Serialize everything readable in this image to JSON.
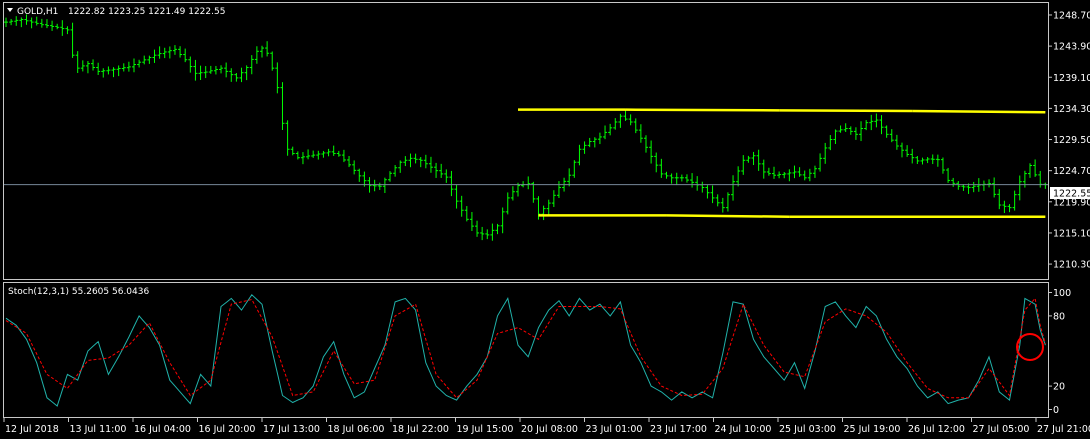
{
  "colors": {
    "background": "#000000",
    "frame": "#c8c8c8",
    "bars": "#00ff00",
    "trendlines": "#ffff00",
    "stoch_main": "#20b2aa",
    "stoch_signal": "#ff0000",
    "annotation_circle": "#ff0000",
    "price_line": "#778899"
  },
  "header": {
    "symbol": "GOLD,H1",
    "ohlc": "1222.82 1223.25 1221.49 1222.55",
    "arrow_icon": "triangle-down-icon"
  },
  "stoch_header": {
    "title": "Stoch(12,3,1) 55.2605 56.0436"
  },
  "chart_data": [
    {
      "type": "line",
      "title": "GOLD,H1",
      "representation": "price bars (H1)",
      "ylim": [
        1208.0,
        1250.7
      ],
      "y_ticks": [
        "1248.70",
        "1243.90",
        "1239.10",
        "1234.30",
        "1229.50",
        "1224.70",
        "1219.90",
        "1215.10",
        "1210.30"
      ],
      "current_price": "1222.55",
      "x_ticks": [
        "12 Jul 2018",
        "13 Jul 11:00",
        "16 Jul 04:00",
        "16 Jul 20:00",
        "17 Jul 13:00",
        "18 Jul 06:00",
        "18 Jul 22:00",
        "19 Jul 15:00",
        "20 Jul 08:00",
        "23 Jul 01:00",
        "23 Jul 17:00",
        "24 Jul 10:00",
        "25 Jul 03:00",
        "25 Jul 19:00",
        "26 Jul 12:00",
        "27 Jul 05:00",
        "27 Jul 21:00"
      ],
      "anchors": [
        [
          0,
          1247.6
        ],
        [
          3,
          1248.0
        ],
        [
          7,
          1247.2
        ],
        [
          10,
          1246.8
        ],
        [
          12,
          1246.4
        ],
        [
          13,
          1242.5
        ],
        [
          14,
          1240.5
        ],
        [
          16,
          1241.2
        ],
        [
          18,
          1240.0
        ],
        [
          20,
          1240.2
        ],
        [
          24,
          1240.7
        ],
        [
          29,
          1242.5
        ],
        [
          31,
          1243.0
        ],
        [
          33,
          1243.4
        ],
        [
          35,
          1241.8
        ],
        [
          37,
          1239.7
        ],
        [
          39,
          1239.9
        ],
        [
          42,
          1240.5
        ],
        [
          45,
          1239.0
        ],
        [
          47,
          1240.6
        ],
        [
          49,
          1243.1
        ],
        [
          50,
          1243.6
        ],
        [
          51,
          1242.8
        ],
        [
          52,
          1240.5
        ],
        [
          53,
          1237.5
        ],
        [
          54,
          1232.0
        ],
        [
          55,
          1228.0
        ],
        [
          57,
          1226.7
        ],
        [
          60,
          1227.1
        ],
        [
          63,
          1227.6
        ],
        [
          65,
          1227.1
        ],
        [
          67,
          1225.6
        ],
        [
          69,
          1223.9
        ],
        [
          71,
          1222.4
        ],
        [
          73,
          1222.3
        ],
        [
          75,
          1224.3
        ],
        [
          77,
          1226.0
        ],
        [
          79,
          1226.6
        ],
        [
          81,
          1226.3
        ],
        [
          84,
          1224.7
        ],
        [
          86,
          1223.7
        ],
        [
          88,
          1220.0
        ],
        [
          90,
          1217.2
        ],
        [
          92,
          1215.1
        ],
        [
          94,
          1214.8
        ],
        [
          96,
          1216.2
        ],
        [
          98,
          1220.5
        ],
        [
          100,
          1222.4
        ],
        [
          102,
          1222.7
        ],
        [
          104,
          1218.0
        ],
        [
          106,
          1219.7
        ],
        [
          108,
          1222.1
        ],
        [
          110,
          1224.0
        ],
        [
          112,
          1228.0
        ],
        [
          114,
          1229.2
        ],
        [
          116,
          1229.9
        ],
        [
          118,
          1231.3
        ],
        [
          120,
          1233.1
        ],
        [
          122,
          1232.2
        ],
        [
          124,
          1229.7
        ],
        [
          126,
          1226.9
        ],
        [
          128,
          1224.2
        ],
        [
          130,
          1223.6
        ],
        [
          132,
          1223.6
        ],
        [
          134,
          1222.9
        ],
        [
          136,
          1222.1
        ],
        [
          138,
          1220.5
        ],
        [
          140,
          1219.0
        ],
        [
          142,
          1223.0
        ],
        [
          144,
          1226.3
        ],
        [
          146,
          1227.0
        ],
        [
          148,
          1224.5
        ],
        [
          150,
          1224.0
        ],
        [
          152,
          1224.2
        ],
        [
          154,
          1224.5
        ],
        [
          156,
          1223.6
        ],
        [
          158,
          1225.0
        ],
        [
          160,
          1228.2
        ],
        [
          162,
          1230.8
        ],
        [
          164,
          1231.2
        ],
        [
          166,
          1230.3
        ],
        [
          168,
          1232.1
        ],
        [
          170,
          1232.5
        ],
        [
          172,
          1230.3
        ],
        [
          174,
          1228.5
        ],
        [
          176,
          1227.2
        ],
        [
          178,
          1226.2
        ],
        [
          180,
          1226.5
        ],
        [
          182,
          1226.4
        ],
        [
          184,
          1223.2
        ],
        [
          186,
          1222.3
        ],
        [
          188,
          1222.1
        ],
        [
          190,
          1222.5
        ],
        [
          192,
          1222.7
        ],
        [
          194,
          1219.4
        ],
        [
          196,
          1219.0
        ],
        [
          198,
          1223.0
        ],
        [
          200,
          1225.5
        ],
        [
          202,
          1222.6
        ],
        [
          203,
          1222.55
        ]
      ],
      "trendlines": [
        {
          "name": "resistance",
          "segments": [
            [
              100,
              1234.1
            ],
            [
              121,
              1234.1
            ],
            [
              151,
              1234.0
            ],
            [
              177,
              1233.9
            ],
            [
              203,
              1233.7
            ]
          ]
        },
        {
          "name": "support",
          "segments": [
            [
              104,
              1217.8
            ],
            [
              129,
              1217.8
            ],
            [
              153,
              1217.6
            ],
            [
              203,
              1217.6
            ]
          ]
        }
      ]
    },
    {
      "type": "line",
      "title": "Stoch(12,3,1) 55.2605 56.0436",
      "ylim": [
        -3,
        103
      ],
      "y_ticks": [
        "100",
        "80",
        "20",
        "0"
      ],
      "series": [
        {
          "name": "main",
          "anchors": [
            [
              0,
              78
            ],
            [
              2,
              72
            ],
            [
              4,
              60
            ],
            [
              6,
              40
            ],
            [
              8,
              10
            ],
            [
              10,
              3
            ],
            [
              12,
              30
            ],
            [
              14,
              25
            ],
            [
              16,
              50
            ],
            [
              18,
              58
            ],
            [
              20,
              30
            ],
            [
              22,
              45
            ],
            [
              24,
              62
            ],
            [
              26,
              80
            ],
            [
              28,
              70
            ],
            [
              30,
              55
            ],
            [
              32,
              25
            ],
            [
              34,
              15
            ],
            [
              36,
              5
            ],
            [
              38,
              30
            ],
            [
              40,
              20
            ],
            [
              42,
              88
            ],
            [
              44,
              95
            ],
            [
              46,
              85
            ],
            [
              48,
              98
            ],
            [
              50,
              90
            ],
            [
              52,
              50
            ],
            [
              54,
              12
            ],
            [
              56,
              6
            ],
            [
              58,
              10
            ],
            [
              60,
              20
            ],
            [
              62,
              45
            ],
            [
              64,
              58
            ],
            [
              66,
              30
            ],
            [
              68,
              10
            ],
            [
              70,
              15
            ],
            [
              72,
              35
            ],
            [
              74,
              55
            ],
            [
              76,
              92
            ],
            [
              78,
              95
            ],
            [
              80,
              85
            ],
            [
              82,
              40
            ],
            [
              84,
              20
            ],
            [
              86,
              12
            ],
            [
              88,
              8
            ],
            [
              90,
              20
            ],
            [
              92,
              30
            ],
            [
              94,
              45
            ],
            [
              96,
              80
            ],
            [
              98,
              95
            ],
            [
              100,
              55
            ],
            [
              102,
              45
            ],
            [
              104,
              70
            ],
            [
              106,
              85
            ],
            [
              108,
              93
            ],
            [
              110,
              80
            ],
            [
              112,
              95
            ],
            [
              114,
              85
            ],
            [
              116,
              90
            ],
            [
              118,
              80
            ],
            [
              120,
              92
            ],
            [
              122,
              55
            ],
            [
              124,
              40
            ],
            [
              126,
              20
            ],
            [
              128,
              15
            ],
            [
              130,
              8
            ],
            [
              132,
              15
            ],
            [
              134,
              10
            ],
            [
              136,
              15
            ],
            [
              138,
              10
            ],
            [
              140,
              48
            ],
            [
              142,
              92
            ],
            [
              144,
              90
            ],
            [
              146,
              60
            ],
            [
              148,
              45
            ],
            [
              150,
              35
            ],
            [
              152,
              25
            ],
            [
              154,
              40
            ],
            [
              156,
              18
            ],
            [
              158,
              50
            ],
            [
              160,
              88
            ],
            [
              162,
              92
            ],
            [
              164,
              80
            ],
            [
              166,
              70
            ],
            [
              168,
              88
            ],
            [
              170,
              80
            ],
            [
              172,
              60
            ],
            [
              174,
              45
            ],
            [
              176,
              35
            ],
            [
              178,
              20
            ],
            [
              180,
              10
            ],
            [
              182,
              15
            ],
            [
              184,
              5
            ],
            [
              186,
              8
            ],
            [
              188,
              10
            ],
            [
              190,
              25
            ],
            [
              192,
              45
            ],
            [
              194,
              15
            ],
            [
              196,
              8
            ],
            [
              198,
              55
            ],
            [
              199,
              95
            ],
            [
              201,
              90
            ],
            [
              202,
              68
            ],
            [
              203,
              55
            ]
          ]
        },
        {
          "name": "signal",
          "anchors": [
            [
              0,
              76
            ],
            [
              4,
              65
            ],
            [
              8,
              30
            ],
            [
              12,
              18
            ],
            [
              16,
              42
            ],
            [
              20,
              44
            ],
            [
              24,
              55
            ],
            [
              28,
              74
            ],
            [
              32,
              40
            ],
            [
              36,
              12
            ],
            [
              40,
              25
            ],
            [
              44,
              90
            ],
            [
              48,
              94
            ],
            [
              52,
              62
            ],
            [
              56,
              12
            ],
            [
              60,
              15
            ],
            [
              64,
              50
            ],
            [
              68,
              22
            ],
            [
              72,
              25
            ],
            [
              76,
              80
            ],
            [
              80,
              90
            ],
            [
              84,
              30
            ],
            [
              88,
              10
            ],
            [
              92,
              25
            ],
            [
              96,
              65
            ],
            [
              100,
              70
            ],
            [
              104,
              60
            ],
            [
              108,
              88
            ],
            [
              112,
              88
            ],
            [
              116,
              88
            ],
            [
              120,
              86
            ],
            [
              124,
              45
            ],
            [
              128,
              20
            ],
            [
              132,
              12
            ],
            [
              136,
              13
            ],
            [
              140,
              35
            ],
            [
              144,
              90
            ],
            [
              148,
              55
            ],
            [
              152,
              32
            ],
            [
              156,
              28
            ],
            [
              160,
              75
            ],
            [
              164,
              86
            ],
            [
              168,
              80
            ],
            [
              172,
              66
            ],
            [
              176,
              40
            ],
            [
              180,
              18
            ],
            [
              184,
              10
            ],
            [
              188,
              10
            ],
            [
              192,
              35
            ],
            [
              196,
              12
            ],
            [
              199,
              85
            ],
            [
              201,
              95
            ],
            [
              202,
              72
            ],
            [
              203,
              56
            ]
          ]
        }
      ]
    }
  ]
}
